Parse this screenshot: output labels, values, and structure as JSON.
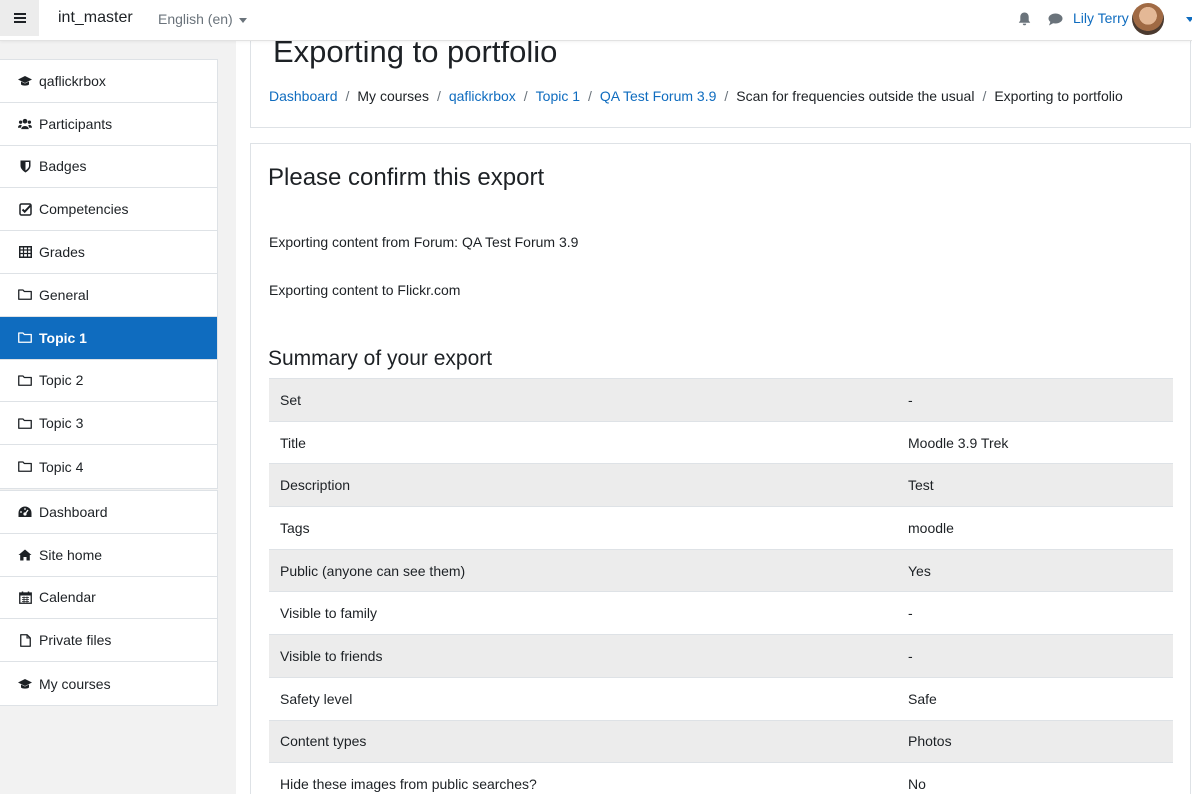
{
  "navbar": {
    "site_name": "int_master",
    "language": "English (en)",
    "user_name": "Lily Terry"
  },
  "sidebar": {
    "course_items": [
      {
        "label": "qaflickrbox",
        "icon": "graduation-cap-icon"
      },
      {
        "label": "Participants",
        "icon": "users-icon"
      },
      {
        "label": "Badges",
        "icon": "shield-icon"
      },
      {
        "label": "Competencies",
        "icon": "check-square-icon"
      },
      {
        "label": "Grades",
        "icon": "table-icon"
      },
      {
        "label": "General",
        "icon": "folder-icon"
      },
      {
        "label": "Topic 1",
        "icon": "folder-icon",
        "active": true
      },
      {
        "label": "Topic 2",
        "icon": "folder-icon"
      },
      {
        "label": "Topic 3",
        "icon": "folder-icon"
      },
      {
        "label": "Topic 4",
        "icon": "folder-icon"
      }
    ],
    "site_items": [
      {
        "label": "Dashboard",
        "icon": "dashboard-icon"
      },
      {
        "label": "Site home",
        "icon": "home-icon"
      },
      {
        "label": "Calendar",
        "icon": "calendar-icon"
      },
      {
        "label": "Private files",
        "icon": "file-icon"
      },
      {
        "label": "My courses",
        "icon": "graduation-cap-icon"
      }
    ]
  },
  "header": {
    "title": "Exporting to portfolio",
    "breadcrumb": [
      {
        "label": "Dashboard",
        "link": true
      },
      {
        "label": "My courses",
        "link": false
      },
      {
        "label": "qaflickrbox",
        "link": true
      },
      {
        "label": "Topic 1",
        "link": true
      },
      {
        "label": "QA Test Forum 3.9",
        "link": true
      },
      {
        "label": "Scan for frequencies outside the usual",
        "link": false
      },
      {
        "label": "Exporting to portfolio",
        "link": false
      }
    ]
  },
  "content": {
    "heading": "Please confirm this export",
    "from_text": "Exporting content from Forum: QA Test Forum 3.9",
    "to_text": "Exporting content to Flickr.com",
    "summary_heading": "Summary of your export",
    "summary_rows": [
      {
        "label": "Set",
        "value": "-"
      },
      {
        "label": "Title",
        "value": "Moodle 3.9 Trek"
      },
      {
        "label": "Description",
        "value": "Test"
      },
      {
        "label": "Tags",
        "value": "moodle"
      },
      {
        "label": "Public (anyone can see them)",
        "value": "Yes"
      },
      {
        "label": "Visible to family",
        "value": "-"
      },
      {
        "label": "Visible to friends",
        "value": "-"
      },
      {
        "label": "Safety level",
        "value": "Safe"
      },
      {
        "label": "Content types",
        "value": "Photos"
      },
      {
        "label": "Hide these images from public searches?",
        "value": "No"
      }
    ]
  },
  "colors": {
    "accent": "#0f6cbf",
    "text": "#1d2125",
    "muted": "#6a737b",
    "stripe": "#ececec"
  }
}
